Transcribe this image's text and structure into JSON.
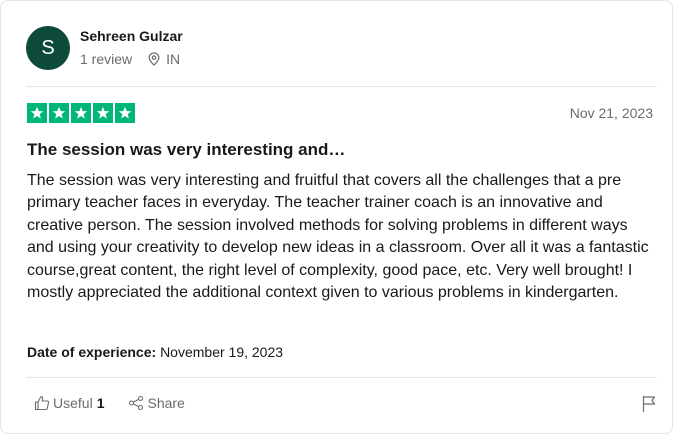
{
  "consumer": {
    "avatar_initial": "S",
    "avatar_color": "#0e4a3c",
    "name": "Sehreen Gulzar",
    "review_count": "1 review",
    "country": "IN"
  },
  "review": {
    "rating": 5,
    "rating_color": "#00b67a",
    "date": "Nov 21, 2023",
    "title": "The session was very interesting and…",
    "body": "The session was very interesting and fruitful that covers all the challenges that a pre primary teacher faces in everyday. The teacher trainer coach is an innovative and creative person. The session involved methods for solving problems in different ways and using your creativity to develop new ideas in a classroom. Over all it was a fantastic course,great content, the right level of complexity, good pace, etc. Very well brought! I mostly appreciated the additional context given to various problems in kindergarten.",
    "experience_label": "Date of experience:",
    "experience_date": "November 19, 2023"
  },
  "actions": {
    "useful_label": "Useful",
    "useful_count": "1",
    "share_label": "Share"
  },
  "icons": {
    "location": "location-pin-icon",
    "useful": "thumbs-up-icon",
    "share": "share-icon",
    "report": "flag-icon",
    "star": "star-icon"
  }
}
